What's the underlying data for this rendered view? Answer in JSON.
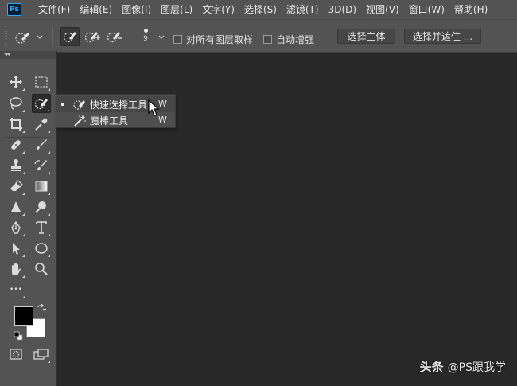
{
  "app": {
    "logo_text": "Ps"
  },
  "menu": [
    "文件(F)",
    "编辑(E)",
    "图像(I)",
    "图层(L)",
    "文字(Y)",
    "选择(S)",
    "滤镜(T)",
    "3D(D)",
    "视图(V)",
    "窗口(W)",
    "帮助(H)"
  ],
  "options": {
    "brush_size": "9",
    "sample_all_layers_label": "对所有图层取样",
    "sample_all_layers_checked": false,
    "auto_enhance_label": "自动增强",
    "auto_enhance_checked": false,
    "select_subject_label": "选择主体",
    "select_and_mask_label": "选择并遮住 ..."
  },
  "toolbar": {
    "collapse_glyph": "◂◂",
    "more_glyph": "•••",
    "foreground_color": "#000000",
    "background_color": "#ffffff"
  },
  "flyout": {
    "items": [
      {
        "label": "快速选择工具",
        "shortcut": "W",
        "icon": "quick-selection-icon",
        "current": true
      },
      {
        "label": "魔棒工具",
        "shortcut": "W",
        "icon": "magic-wand-icon",
        "current": false
      }
    ]
  },
  "watermark": {
    "brand": "头条",
    "handle": "@PS跟我学"
  }
}
